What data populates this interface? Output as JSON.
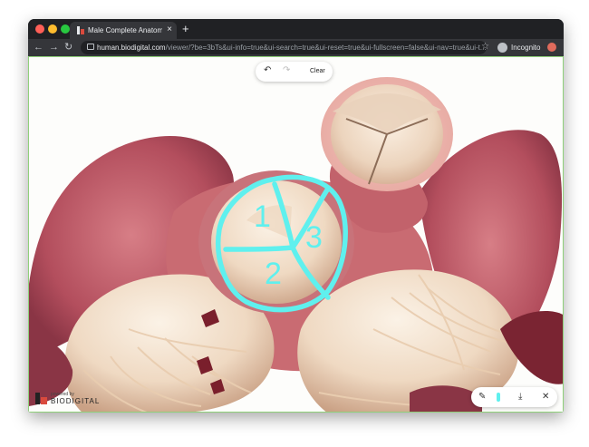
{
  "browser": {
    "tab_title": "Male Complete Anatomy | BioD",
    "tab_close": "×",
    "new_tab": "+",
    "back": "←",
    "forward": "→",
    "reload": "↻",
    "url_host": "human.biodigital.com",
    "url_path": "/viewer/?be=3bTs&ui-info=true&ui-search=true&ui-reset=true&ui-fullscreen=false&ui-nav=true&ui-t...",
    "bookmark_star": "☆",
    "incognito_label": "Incognito"
  },
  "drawing_toolbar": {
    "undo": "↶",
    "redo": "↷",
    "clear_label": "Clear"
  },
  "annotation_labels": [
    "1",
    "2",
    "3"
  ],
  "bottom_tools": {
    "pen": "✎",
    "download": "⤓",
    "close": "✕"
  },
  "logo": {
    "powered_by": "powered by",
    "brand": "BIODIGITAL"
  },
  "colors": {
    "annotation": "#5ff0ee",
    "tissue": "#b85462",
    "valve": "#f1ddc8",
    "frame": "#8fd07a"
  }
}
